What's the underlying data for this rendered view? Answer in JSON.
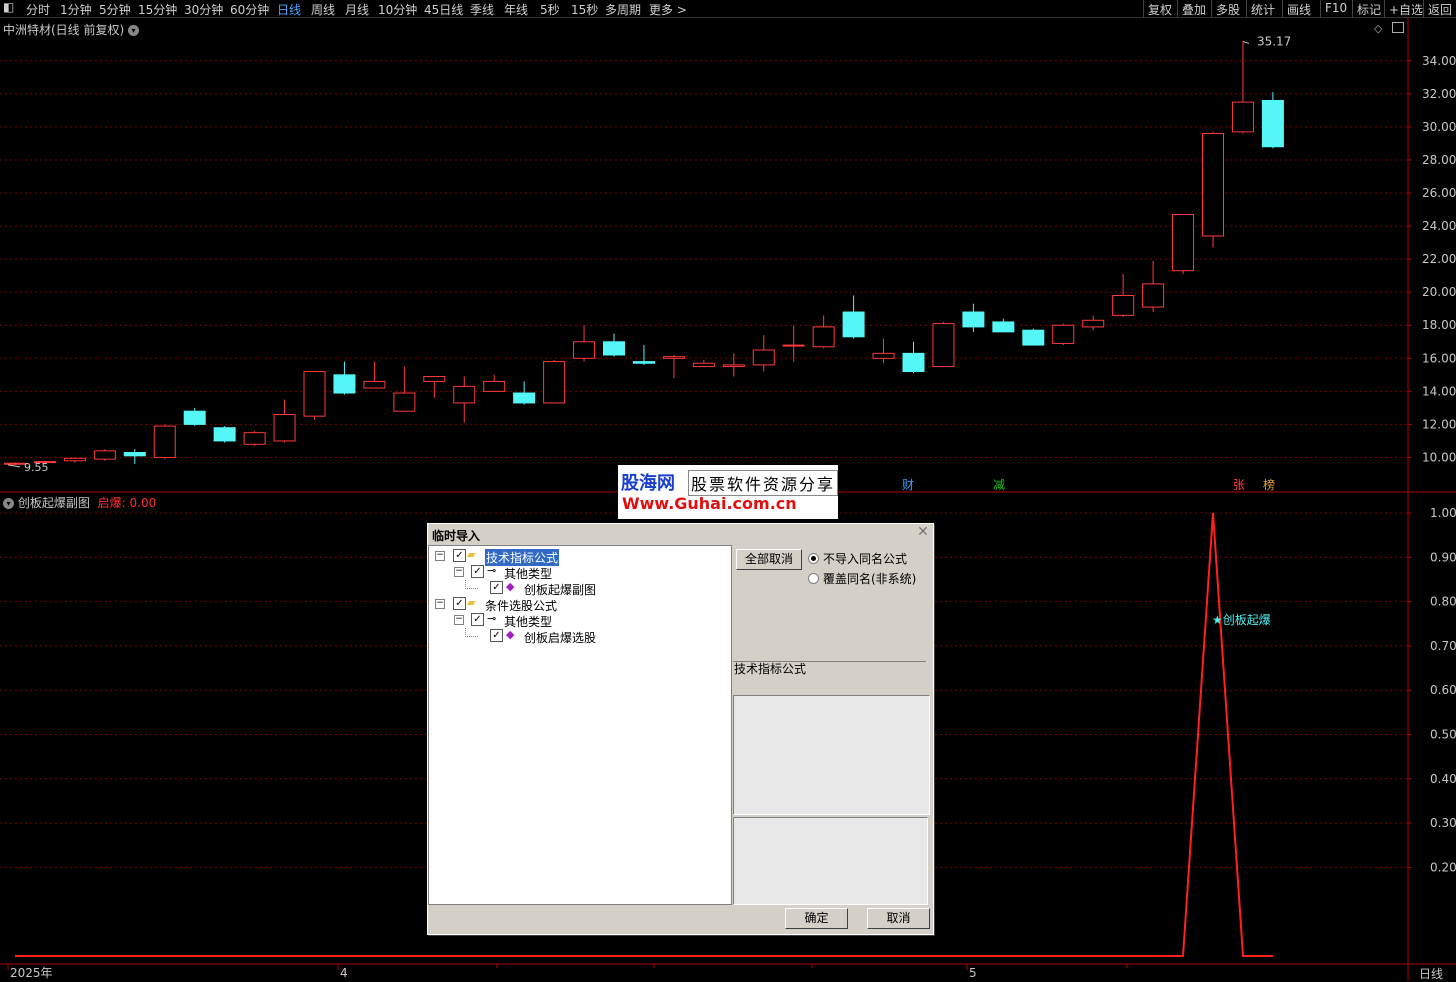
{
  "toolbar": {
    "periods": [
      "分时",
      "1分钟",
      "5分钟",
      "15分钟",
      "30分钟",
      "60分钟",
      "日线",
      "周线",
      "月线",
      "10分钟",
      "45日线",
      "季线",
      "年线",
      "5秒",
      "15秒",
      "多周期",
      "更多 >"
    ],
    "active_period": "日线",
    "right_items": [
      "复权",
      "叠加",
      "多股",
      "统计",
      "画线",
      "F10",
      "标记",
      "+自选",
      "返回"
    ]
  },
  "main_chart": {
    "title": "中洲特材(日线 前复权)",
    "high_label": "35.17",
    "low_label": "9.55",
    "y_ticks": [
      "34.00",
      "32.00",
      "30.00",
      "28.00",
      "26.00",
      "24.00",
      "22.00",
      "20.00",
      "18.00",
      "16.00",
      "14.00",
      "12.00",
      "10.00"
    ],
    "markers": [
      "财",
      "减",
      "张",
      "榜"
    ]
  },
  "sub_chart": {
    "title": "创板起爆副图",
    "value_label": "启爆:",
    "value": "0.00",
    "y_ticks": [
      "1.00",
      "0.90",
      "0.80",
      "0.70",
      "0.60",
      "0.50",
      "0.40",
      "0.30",
      "0.20"
    ],
    "signal_label": "★创板起爆"
  },
  "x_axis": {
    "labels": [
      "2025年",
      "4",
      "5"
    ],
    "period_label": "日线"
  },
  "watermark": {
    "line1": "股海网",
    "line2": "股票软件资源分享",
    "line3": "Www.Guhai.com.cn"
  },
  "dialog": {
    "title": "临时导入",
    "tree": [
      {
        "label": "技术指标公式",
        "level": 0,
        "selected": true
      },
      {
        "label": "其他类型",
        "level": 1
      },
      {
        "label": "创板起爆副图",
        "level": 2
      },
      {
        "label": "条件选股公式",
        "level": 0
      },
      {
        "label": "其他类型",
        "level": 1
      },
      {
        "label": "创板启爆选股",
        "level": 2
      }
    ],
    "deselect_all": "全部取消",
    "radio_options": [
      "不导入同名公式",
      "覆盖同名(非系统)"
    ],
    "info_label": "技术指标公式",
    "ok": "确定",
    "cancel": "取消"
  },
  "chart_data": [
    {
      "type": "candlestick",
      "title": "中洲特材(日线 前复权)",
      "ylim": [
        9,
        35.5
      ],
      "candles": [
        {
          "o": 9.6,
          "h": 9.7,
          "l": 9.55,
          "c": 9.65,
          "up": true
        },
        {
          "o": 9.7,
          "h": 9.8,
          "l": 9.6,
          "c": 9.75,
          "up": true
        },
        {
          "o": 9.8,
          "h": 10.0,
          "l": 9.7,
          "c": 9.95,
          "up": true
        },
        {
          "o": 9.9,
          "h": 10.5,
          "l": 9.8,
          "c": 10.4,
          "up": true
        },
        {
          "o": 10.3,
          "h": 10.5,
          "l": 9.6,
          "c": 10.1,
          "up": false
        },
        {
          "o": 10.0,
          "h": 12.0,
          "l": 9.9,
          "c": 11.9,
          "up": true
        },
        {
          "o": 12.8,
          "h": 13.0,
          "l": 11.9,
          "c": 12.0,
          "up": false
        },
        {
          "o": 11.8,
          "h": 11.9,
          "l": 10.9,
          "c": 11.0,
          "up": false
        },
        {
          "o": 10.8,
          "h": 11.6,
          "l": 10.7,
          "c": 11.5,
          "up": true
        },
        {
          "o": 11.0,
          "h": 13.5,
          "l": 10.9,
          "c": 12.6,
          "up": true
        },
        {
          "o": 12.5,
          "h": 15.2,
          "l": 12.3,
          "c": 15.2,
          "up": true
        },
        {
          "o": 15.0,
          "h": 15.8,
          "l": 13.8,
          "c": 13.9,
          "up": false
        },
        {
          "o": 14.2,
          "h": 15.8,
          "l": 14.2,
          "c": 14.6,
          "up": true
        },
        {
          "o": 12.8,
          "h": 15.5,
          "l": 12.8,
          "c": 13.9,
          "up": true
        },
        {
          "o": 14.6,
          "h": 14.9,
          "l": 13.6,
          "c": 14.9,
          "up": true
        },
        {
          "o": 13.3,
          "h": 14.9,
          "l": 12.1,
          "c": 14.3,
          "up": true
        },
        {
          "o": 14.0,
          "h": 15.0,
          "l": 14.0,
          "c": 14.6,
          "up": true
        },
        {
          "o": 13.9,
          "h": 14.6,
          "l": 13.2,
          "c": 13.3,
          "up": false
        },
        {
          "o": 13.3,
          "h": 15.9,
          "l": 13.3,
          "c": 15.8,
          "up": true
        },
        {
          "o": 16.0,
          "h": 18.0,
          "l": 15.8,
          "c": 17.0,
          "up": true
        },
        {
          "o": 17.0,
          "h": 17.5,
          "l": 16.1,
          "c": 16.2,
          "up": false
        },
        {
          "o": 15.8,
          "h": 16.8,
          "l": 15.6,
          "c": 15.7,
          "up": false
        },
        {
          "o": 16.0,
          "h": 16.2,
          "l": 14.8,
          "c": 16.1,
          "up": true
        },
        {
          "o": 15.5,
          "h": 15.9,
          "l": 15.5,
          "c": 15.7,
          "up": true
        },
        {
          "o": 15.5,
          "h": 16.3,
          "l": 14.9,
          "c": 15.6,
          "up": true
        },
        {
          "o": 15.6,
          "h": 17.4,
          "l": 15.2,
          "c": 16.5,
          "up": true
        },
        {
          "o": 16.8,
          "h": 18.0,
          "l": 15.8,
          "c": 16.8,
          "up": true
        },
        {
          "o": 16.7,
          "h": 18.6,
          "l": 16.6,
          "c": 17.9,
          "up": true
        },
        {
          "o": 18.8,
          "h": 19.8,
          "l": 17.2,
          "c": 17.3,
          "up": false
        },
        {
          "o": 16.0,
          "h": 17.2,
          "l": 15.7,
          "c": 16.3,
          "up": true
        },
        {
          "o": 16.3,
          "h": 17.0,
          "l": 15.1,
          "c": 15.2,
          "up": false
        },
        {
          "o": 15.5,
          "h": 18.2,
          "l": 15.5,
          "c": 18.1,
          "up": true
        },
        {
          "o": 18.8,
          "h": 19.3,
          "l": 17.6,
          "c": 17.9,
          "up": false
        },
        {
          "o": 18.2,
          "h": 18.4,
          "l": 17.6,
          "c": 17.6,
          "up": false
        },
        {
          "o": 17.7,
          "h": 17.8,
          "l": 16.8,
          "c": 16.8,
          "up": false
        },
        {
          "o": 16.9,
          "h": 18.1,
          "l": 16.8,
          "c": 18.0,
          "up": true
        },
        {
          "o": 17.9,
          "h": 18.6,
          "l": 17.7,
          "c": 18.3,
          "up": true
        },
        {
          "o": 18.6,
          "h": 21.1,
          "l": 18.5,
          "c": 19.8,
          "up": true
        },
        {
          "o": 19.1,
          "h": 21.9,
          "l": 18.8,
          "c": 20.5,
          "up": true
        },
        {
          "o": 21.3,
          "h": 24.7,
          "l": 21.1,
          "c": 24.7,
          "up": true
        },
        {
          "o": 23.4,
          "h": 29.7,
          "l": 22.7,
          "c": 29.6,
          "up": true
        },
        {
          "o": 29.7,
          "h": 35.17,
          "l": 29.6,
          "c": 31.5,
          "up": true
        },
        {
          "o": 31.6,
          "h": 32.1,
          "l": 28.7,
          "c": 28.8,
          "up": false
        }
      ]
    },
    {
      "type": "line",
      "title": "创板起爆副图",
      "ylim": [
        0,
        1.05
      ],
      "series": [
        {
          "name": "启爆",
          "values": [
            0,
            0,
            0,
            0,
            0,
            0,
            0,
            0,
            0,
            0,
            0,
            0,
            0,
            0,
            0,
            0,
            0,
            0,
            0,
            0,
            0,
            0,
            0,
            0,
            0,
            0,
            0,
            0,
            0,
            0,
            0,
            0,
            0,
            0,
            0,
            0,
            0,
            0,
            0,
            0,
            1,
            0,
            0
          ]
        }
      ]
    }
  ]
}
